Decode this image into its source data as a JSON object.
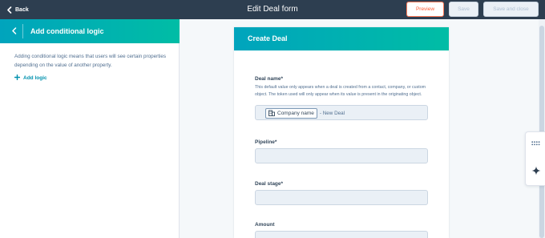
{
  "header": {
    "back_label": "Back",
    "title": "Edit Deal form",
    "preview_label": "Preview",
    "save_label": "Save",
    "save_close_label": "Save and close"
  },
  "panel": {
    "title": "Add conditional logic",
    "description": "Adding conditional logic means that users will see certain properties depending on the value of another property.",
    "add_logic_label": "Add logic"
  },
  "form": {
    "title": "Create Deal",
    "fields": [
      {
        "label": "Deal name*",
        "help": "This default value only appears when a deal is created from a contact, company, or custom object. The token used will only appear when its value is present in the originating object.",
        "token_label": "Company name",
        "token_suffix": "- New Deal"
      },
      {
        "label": "Pipeline*"
      },
      {
        "label": "Deal stage*"
      },
      {
        "label": "Amount"
      }
    ]
  },
  "colors": {
    "topbar": "#2d3e50",
    "accent_gradient_start": "#00a4bd",
    "accent_gradient_end": "#00bda5",
    "preview_border": "#ff7a59",
    "link": "#0091ae"
  },
  "icons": {
    "back": "chevron-left-icon",
    "panel_back": "chevron-left-icon",
    "add_logic": "plus-icon",
    "token": "company-building-icon",
    "tool_1": "grid-dots-icon",
    "tool_2": "sparkle-icon"
  }
}
